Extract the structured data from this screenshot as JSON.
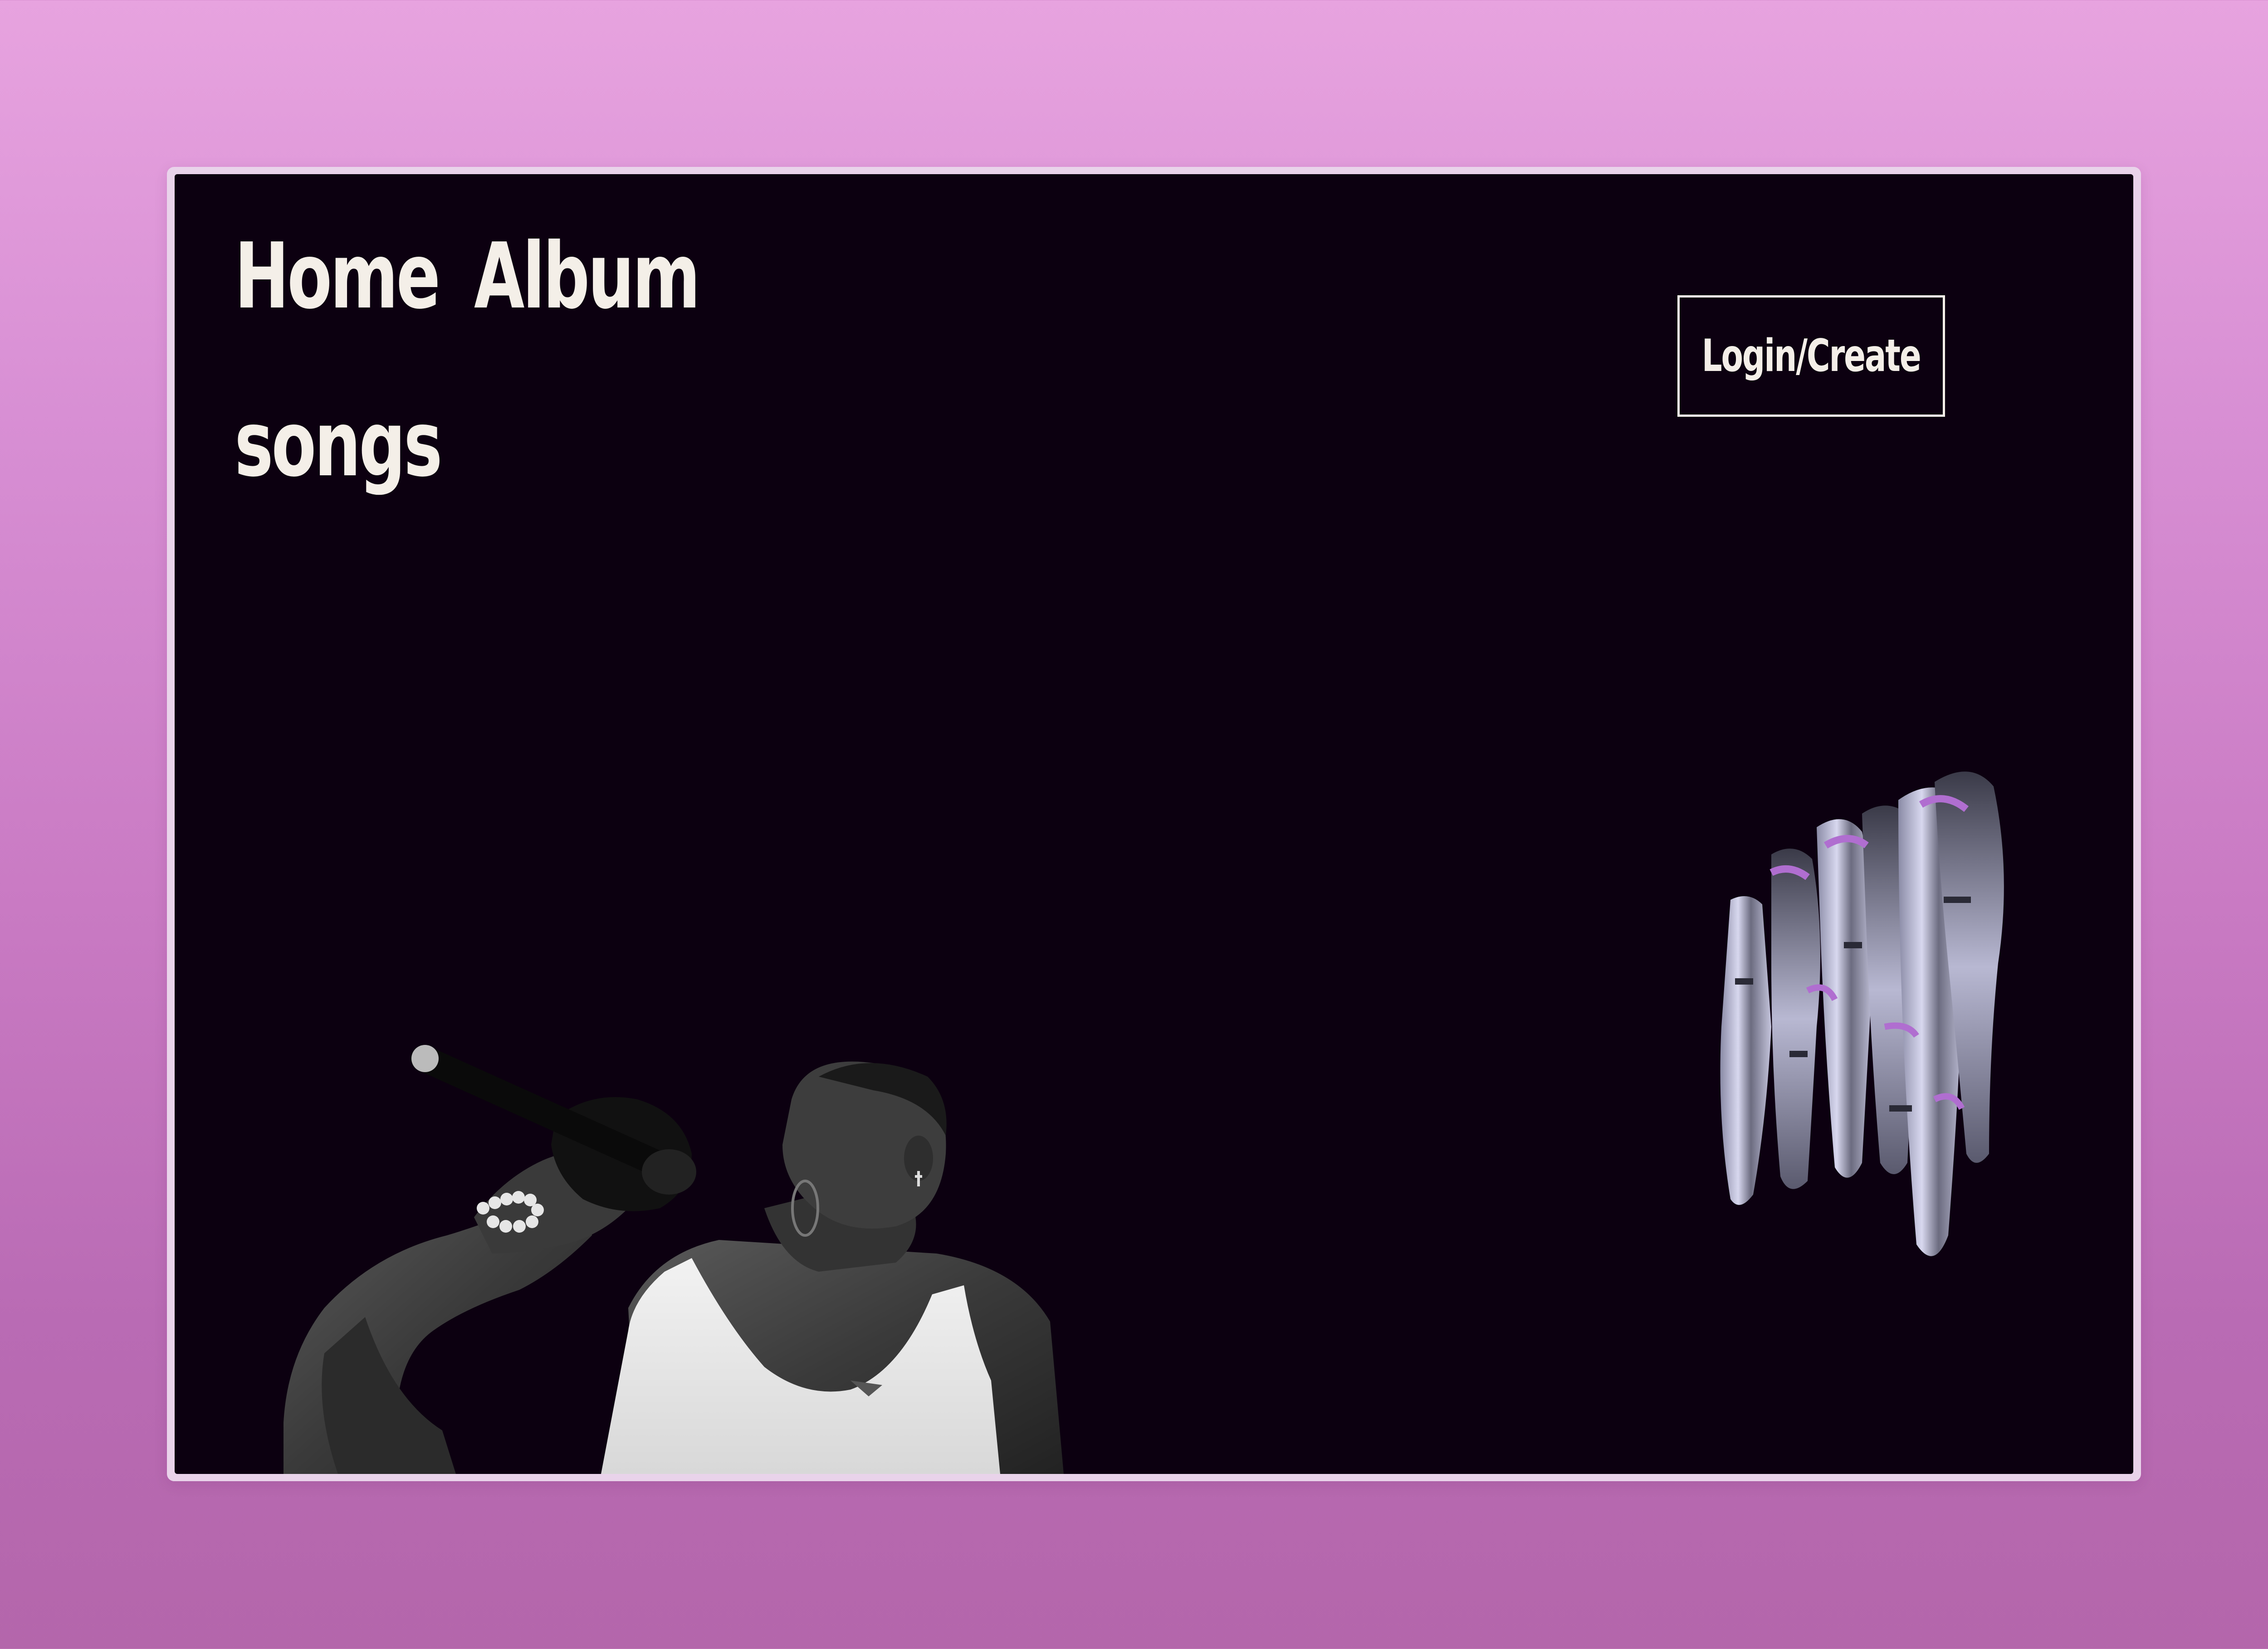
{
  "nav": {
    "home_label": "Home",
    "album_label": "Album",
    "songs_label": "songs"
  },
  "account": {
    "login_label": "Login/Create"
  },
  "colors": {
    "page_background_top": "#e7a3df",
    "page_background_bottom": "#b466ab",
    "canvas_background": "#0c0010",
    "text": "#f4efe8",
    "accent_purple": "#b06ed0"
  },
  "images": {
    "hero_photo": "singer-with-microphone",
    "decoration": "melted-chrome-sculpture"
  }
}
